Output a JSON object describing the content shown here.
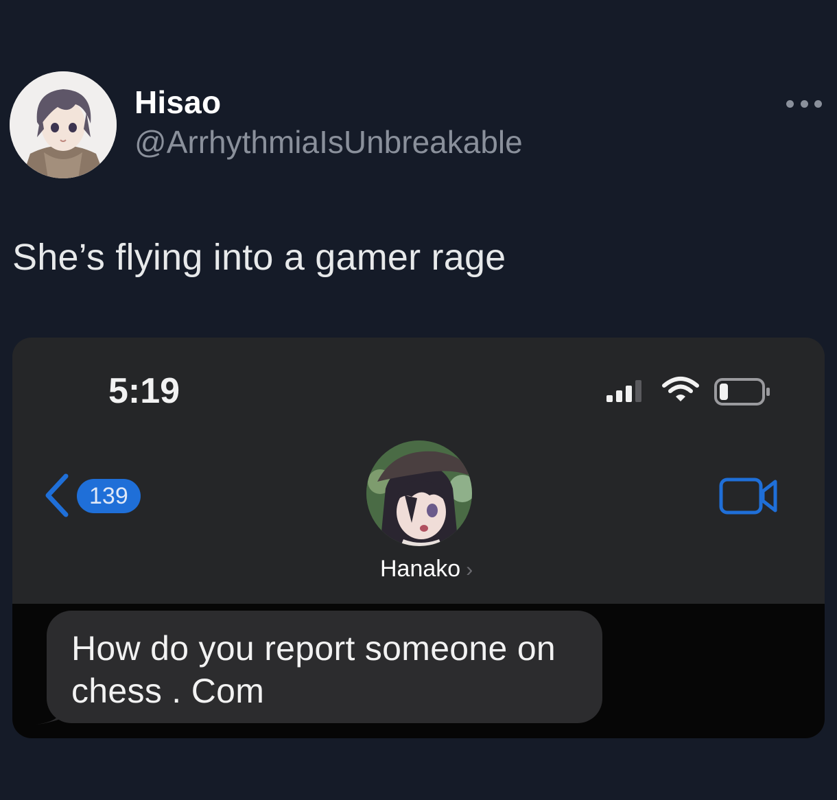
{
  "tweet": {
    "author": {
      "display_name": "Hisao",
      "handle": "@ArrhythmiaIsUnbreakable"
    },
    "text": "She’s flying into a gamer rage",
    "more_icon": "more-horizontal-icon"
  },
  "phone": {
    "status_bar": {
      "time": "5:19",
      "icons": [
        "cellular-signal-icon",
        "wifi-icon",
        "battery-icon"
      ]
    },
    "nav": {
      "unread_count": "139",
      "contact_name": "Hanako",
      "accent_color": "#1f6fd8"
    },
    "messages": [
      {
        "direction": "incoming",
        "text": "How do you report someone on chess . Com"
      }
    ]
  },
  "colors": {
    "background": "#151b28",
    "handle_gray": "#8a909b",
    "bubble_gray": "#2c2c2e"
  }
}
